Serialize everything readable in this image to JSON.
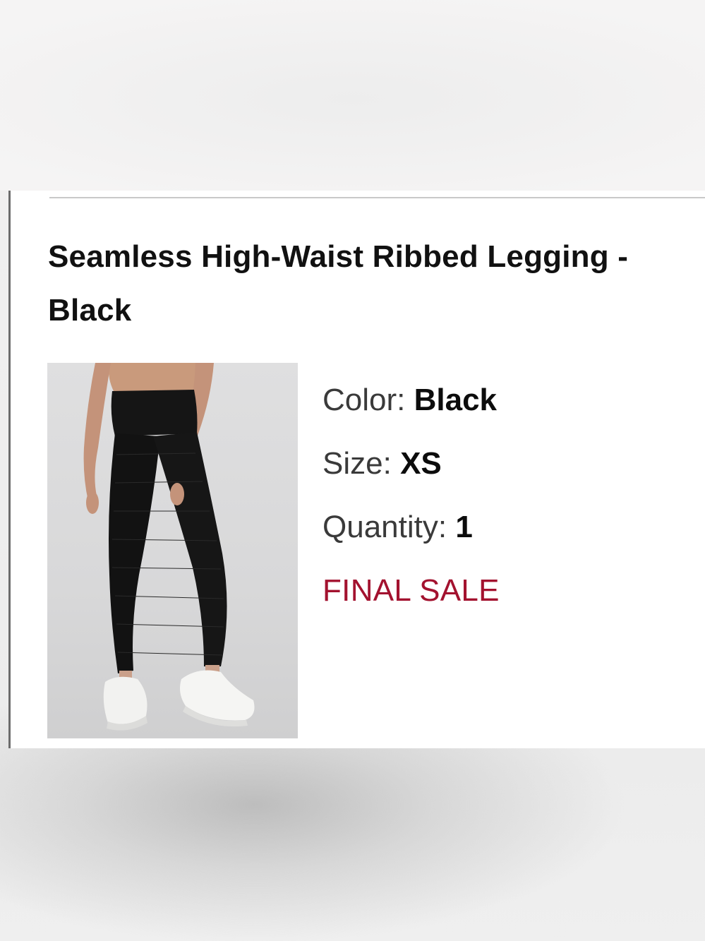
{
  "product": {
    "title": "Seamless High-Waist Ribbed Legging - Black",
    "image_alt": "Model wearing black ribbed leggings and white sneakers"
  },
  "details": {
    "color_label": "Color:",
    "color_value": "Black",
    "size_label": "Size:",
    "size_value": "XS",
    "quantity_label": "Quantity:",
    "quantity_value": "1",
    "sale_notice": "FINAL SALE"
  },
  "colors": {
    "title_text": "#111111",
    "label_text": "#3a3a3a",
    "final_sale": "#a3122f",
    "card_border": "#6c6c6c",
    "divider": "#c9c9c9"
  }
}
